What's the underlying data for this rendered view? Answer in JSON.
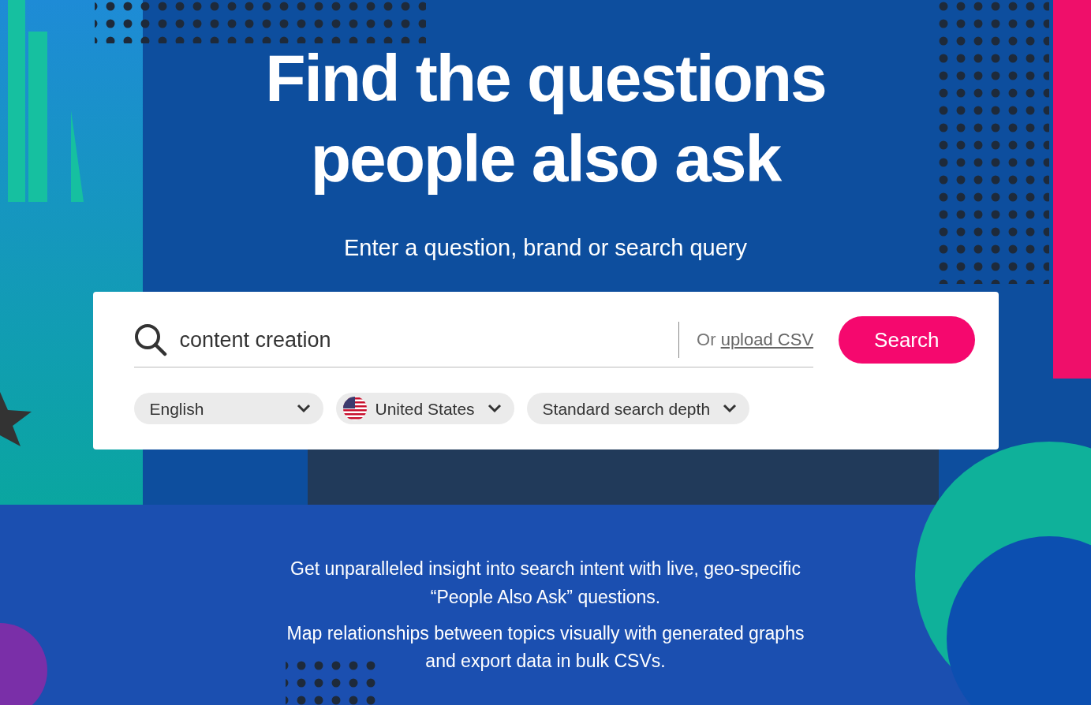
{
  "hero": {
    "title_lines": [
      "Find the questions",
      "people also ask"
    ],
    "subtitle": "Enter a question, brand or search query"
  },
  "search": {
    "value": "content creation",
    "upload_prefix": "Or",
    "upload_link": "upload CSV",
    "button": "Search"
  },
  "dropdowns": [
    {
      "kind": "plain",
      "label": "English"
    },
    {
      "kind": "flag",
      "label": "United States"
    },
    {
      "kind": "plain",
      "label": "Standard search depth"
    }
  ],
  "paragraphs": [
    "Get unparalleled insight into search intent with live, geo-specific “People Also Ask” questions.",
    "Map relationships between topics visually with generated graphs and export data in bulk CSVs."
  ]
}
